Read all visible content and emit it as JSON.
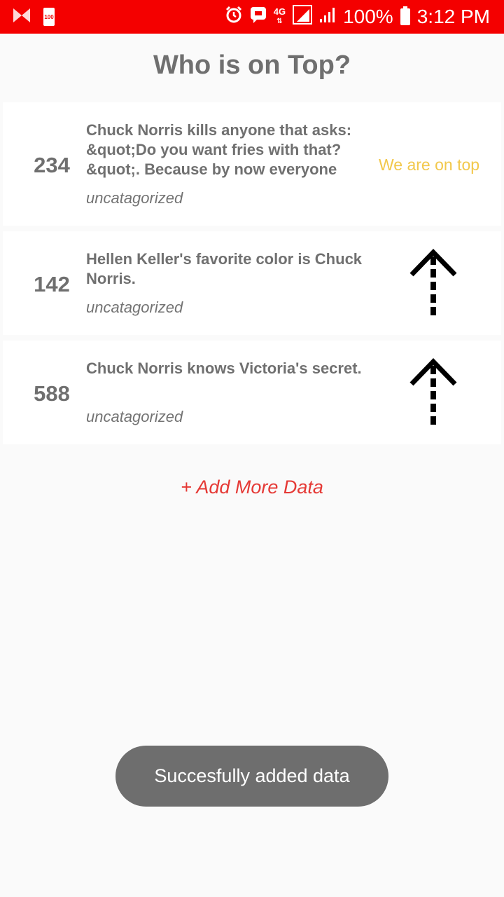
{
  "status_bar": {
    "battery_saver_label": "100",
    "network_label": "4G",
    "battery_percent": "100%",
    "time": "3:12 PM",
    "icons": [
      "app-bowtie-icon",
      "battery-saver-icon",
      "alarm-icon",
      "message-icon",
      "network-4g-icon",
      "signal-icon",
      "wifi-signal-icon",
      "battery-icon"
    ]
  },
  "header": {
    "title": "Who is on Top?"
  },
  "items": [
    {
      "score": "234",
      "text": "Chuck Norris kills anyone that asks: &quot;Do you want fries with that?&quot;. Because by now everyone",
      "category": "uncatagorized",
      "status": "We are on top"
    },
    {
      "score": "142",
      "text": "Hellen Keller's favorite color is Chuck Norris.",
      "category": "uncatagorized",
      "action_icon": "upvote-arrow-icon"
    },
    {
      "score": "588",
      "text": "Chuck Norris knows Victoria's secret.",
      "category": "uncatagorized",
      "action_icon": "upvote-arrow-icon"
    }
  ],
  "add_more_label": "+ Add More Data",
  "toast": {
    "message": "Succesfully added data"
  },
  "colors": {
    "status_bar": "#f40000",
    "on_top": "#f2c84b",
    "add_more": "#e53935",
    "toast_bg": "#6e6e6e"
  }
}
